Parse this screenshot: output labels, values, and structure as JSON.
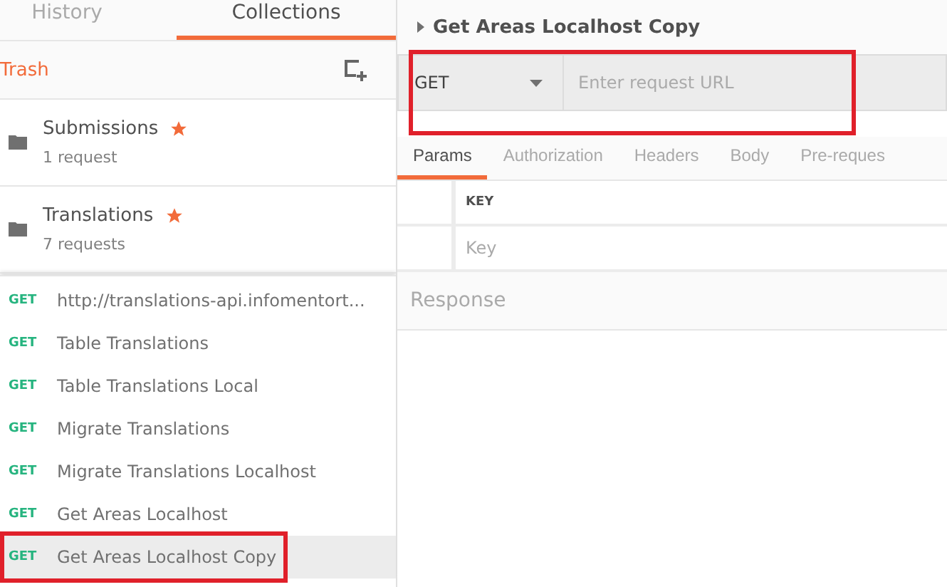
{
  "sidebar": {
    "tabs": [
      {
        "label": "History",
        "selected": false
      },
      {
        "label": "Collections",
        "selected": true
      }
    ],
    "trash": "Trash",
    "collections": [
      {
        "name": "Submissions",
        "count": "1 request",
        "starred": true
      },
      {
        "name": "Translations",
        "count": "7 requests",
        "starred": true
      }
    ],
    "requests": [
      {
        "method": "GET",
        "name": "http://translations-api.infomentort...",
        "selected": false,
        "highlighted": false
      },
      {
        "method": "GET",
        "name": "Table Translations",
        "selected": false,
        "highlighted": false
      },
      {
        "method": "GET",
        "name": "Table Translations Local",
        "selected": false,
        "highlighted": false
      },
      {
        "method": "GET",
        "name": "Migrate Translations",
        "selected": false,
        "highlighted": false
      },
      {
        "method": "GET",
        "name": "Migrate Translations Localhost",
        "selected": false,
        "highlighted": false
      },
      {
        "method": "GET",
        "name": "Get Areas Localhost",
        "selected": false,
        "highlighted": false
      },
      {
        "method": "GET",
        "name": "Get Areas Localhost Copy",
        "selected": true,
        "highlighted": true
      }
    ]
  },
  "main": {
    "title": "Get Areas Localhost Copy",
    "url_bar": {
      "method": "GET",
      "placeholder": "Enter request URL",
      "highlighted": true
    },
    "tabs": [
      {
        "label": "Params",
        "selected": true
      },
      {
        "label": "Authorization",
        "selected": false
      },
      {
        "label": "Headers",
        "selected": false
      },
      {
        "label": "Body",
        "selected": false
      },
      {
        "label": "Pre-reques",
        "selected": false
      }
    ],
    "params": {
      "column": "KEY",
      "key_placeholder": "Key"
    },
    "response": "Response"
  }
}
